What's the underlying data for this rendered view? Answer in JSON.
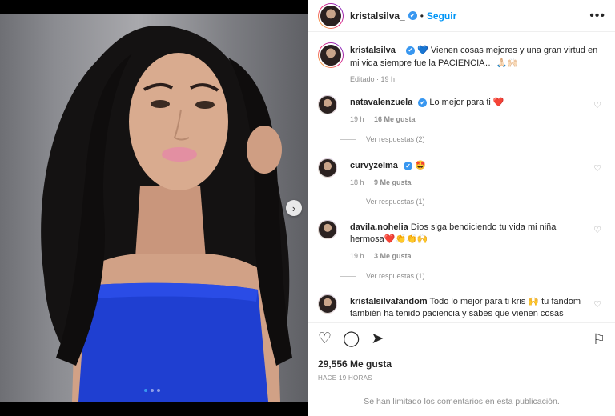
{
  "post": {
    "username": "kristalsilva_",
    "separator": "•",
    "follow_label": "Seguir",
    "more_label": "•••",
    "carousel": {
      "slides": 3,
      "active_index": 0,
      "next_icon": "›"
    }
  },
  "caption": {
    "username": "kristalsilva_",
    "text": " 💙 Vienen cosas mejores y una gran virtud en mi vida siempre fue la PACIENCIA… 🙏🏻🙌🏻",
    "meta": "Editado · 19 h"
  },
  "comments": [
    {
      "username": "natavalenzuela",
      "verified": true,
      "text": "Lo mejor para ti ❤️",
      "time": "19 h",
      "likes": "16 Me gusta",
      "replies": "Ver respuestas (2)"
    },
    {
      "username": "curvyzelma",
      "verified": true,
      "text": "🤩",
      "time": "18 h",
      "likes": "9 Me gusta",
      "replies": "Ver respuestas (1)"
    },
    {
      "username": "davila.nohelia",
      "verified": false,
      "text": "Dios siga bendiciendo tu vida mi niña hermosa❤️👏👏🙌",
      "time": "19 h",
      "likes": "3 Me gusta",
      "replies": "Ver respuestas (1)"
    },
    {
      "username": "kristalsilvafandom",
      "verified": false,
      "text": "Todo lo mejor para ti kris 🙌 tu fandom también ha tenido paciencia y sabes que vienen cosas",
      "time": "",
      "likes": "",
      "replies": ""
    }
  ],
  "actions": {
    "like_icon": "♡",
    "comment_icon": "◯",
    "share_icon": "➤",
    "save_icon": "⚐",
    "likes_count": "29,556",
    "likes_label": "Me gusta",
    "time_ago": "HACE 19 HORAS",
    "comments_limited": "Se han limitado los comentarios en esta publicación."
  },
  "icons": {
    "verified": "✔",
    "heart_small": "♡"
  },
  "colors": {
    "accent": "#0095f6",
    "verified": "#3897f0",
    "dress": "#1f3fd1",
    "muted": "#8e8e8e"
  }
}
